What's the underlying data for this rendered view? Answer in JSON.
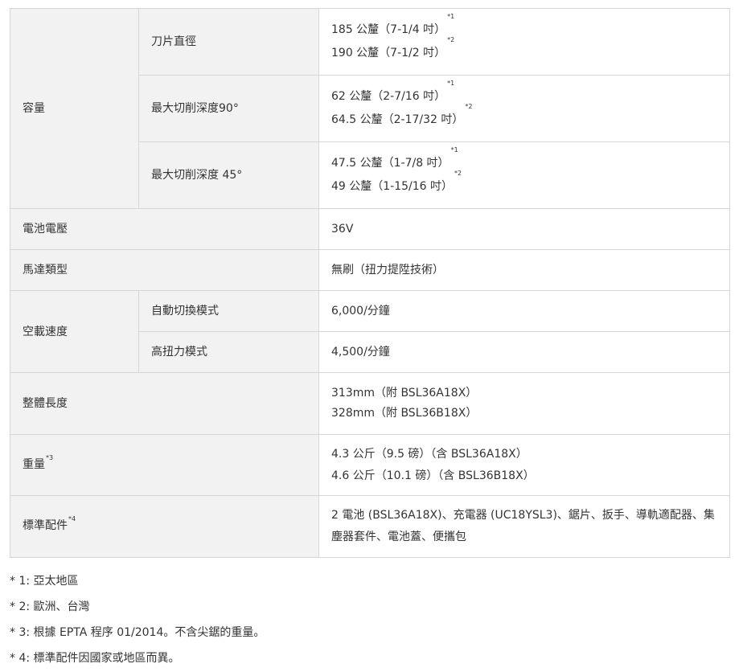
{
  "rows": {
    "capacity": {
      "label": "容量",
      "blade": {
        "sub": "刀片直徑",
        "v1": "185 公釐（7-1/4 吋）",
        "s1": "*1",
        "v2": "190 公釐（7-1/2 吋）",
        "s2": "*2"
      },
      "depth90": {
        "sub": "最大切削深度90°",
        "v1": "62 公釐（2-7/16 吋）",
        "s1": "*1",
        "v2": "64.5 公釐（2-17/32 吋）",
        "s2": "*2"
      },
      "depth45": {
        "sub": "最大切削深度 45°",
        "v1": "47.5 公釐（1-7/8 吋）",
        "s1": "*1",
        "v2": "49 公釐（1-15/16 吋）",
        "s2": "*2"
      }
    },
    "voltage": {
      "label": "電池電壓",
      "value": "36V"
    },
    "motor": {
      "label": "馬達類型",
      "value": "無刷（扭力提陞技術）"
    },
    "noload": {
      "label": "空載速度",
      "auto": {
        "sub": "自動切換模式",
        "value": "6,000/分鐘"
      },
      "high": {
        "sub": "高扭力模式",
        "value": "4,500/分鐘"
      }
    },
    "length": {
      "label": "整體長度",
      "v1": "313mm（附 BSL36A18X）",
      "v2": "328mm（附 BSL36B18X）"
    },
    "weight": {
      "label": "重量",
      "sup": "*3",
      "v1": "4.3 公斤（9.5 磅）（含 BSL36A18X）",
      "v2": "4.6 公斤（10.1 磅）（含 BSL36B18X）"
    },
    "accessories": {
      "label": "標準配件",
      "sup": "*4",
      "value": "2 電池 (BSL36A18X)、充電器 (UC18YSL3)、鋸片、扳手、導軌適配器、集塵器套件、電池蓋、便攜包"
    }
  },
  "notes": [
    "* 1: 亞太地區",
    "* 2: 歐洲、台灣",
    "* 3: 根據 EPTA 程序 01/2014。不含尖鋸的重量。",
    "* 4: 標準配件因國家或地區而異。"
  ]
}
